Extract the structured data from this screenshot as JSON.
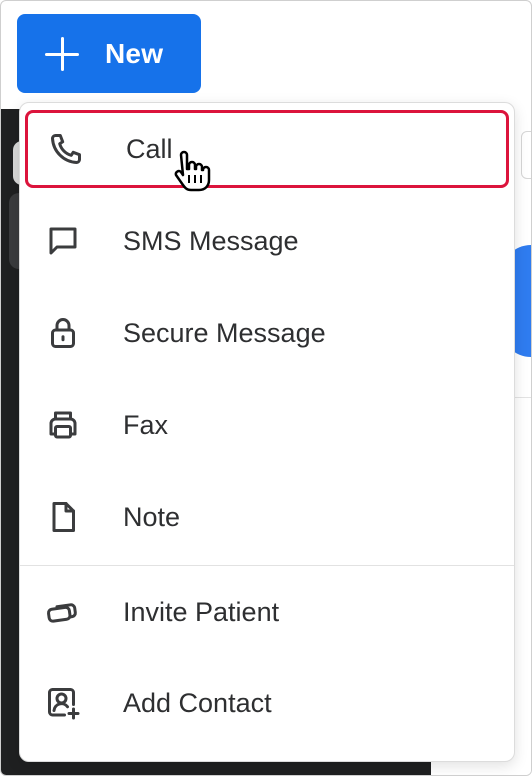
{
  "toolbar": {
    "new_label": "New",
    "new_icon": "plus-icon",
    "accent_color": "#1672ea"
  },
  "menu": {
    "items": [
      {
        "label": "Call",
        "icon": "phone-icon",
        "highlighted": true
      },
      {
        "label": "SMS Message",
        "icon": "chat-bubble-icon"
      },
      {
        "label": "Secure Message",
        "icon": "lock-icon"
      },
      {
        "label": "Fax",
        "icon": "printer-icon"
      },
      {
        "label": "Note",
        "icon": "document-icon"
      },
      {
        "label": "Invite Patient",
        "icon": "cards-icon"
      },
      {
        "label": "Add Contact",
        "icon": "add-contact-icon"
      }
    ],
    "highlight_color": "#dc143c"
  },
  "cursor": {
    "type": "hand-pointer"
  }
}
